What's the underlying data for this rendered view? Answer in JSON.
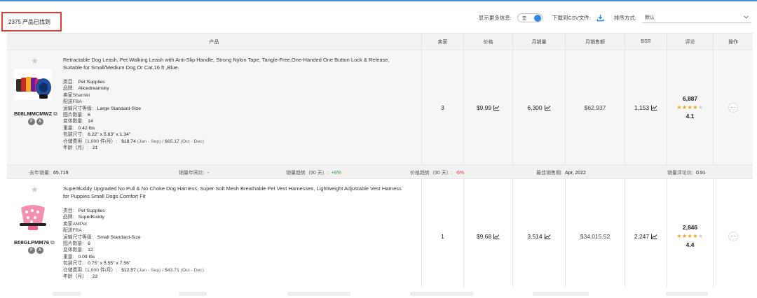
{
  "header": {
    "product_count": "2375 产品已找到",
    "show_more_label": "显示更多信息:",
    "toggle_text": "是",
    "download_label": "下载到CSV文件:",
    "sort_label": "排序方式:",
    "sort_value": "默认"
  },
  "columns": {
    "product": "产品",
    "seller": "卖家",
    "price": "价格",
    "monthly_sales": "月销量",
    "monthly_revenue": "月销售额",
    "bsr": "BSR",
    "reviews": "评论",
    "actions": "操作"
  },
  "products": [
    {
      "asin": "B08LMMCMWZ",
      "title_line1": "Retractable Dog Leash, Pet Walking Leash with Anti-Slip Handle, Strong Nylon Tape, Tangle-Free,One-Handed One Button Lock & Release,",
      "title_line2": "Suitable for Small/Medium Dog Or Cat,16 ft ,Blue.",
      "details": {
        "category_label": "类目:",
        "category": "Pet Supplies",
        "brand_label": "品牌:",
        "brand": "Alicedreamsky",
        "seller_label": "卖家",
        "seller": "Sharniki",
        "fulfillment_label": "配送",
        "fulfillment": "FBA",
        "size_tier_label": "运输尺寸等级:",
        "size_tier": "Large Standard-Size",
        "images_label": "图片数量:",
        "images": "6",
        "variants_label": "变体数量:",
        "variants": "14",
        "weight_label": "重量:",
        "weight": "0.42 lbs",
        "dims_label": "包装尺寸:",
        "dims": "6.22\" x 5.63\" x 1.34\"",
        "storage_label": "仓储费用（1,000 件/月）:",
        "storage_a": "$18.74",
        "storage_a_period": "(Jan - Sep) /",
        "storage_b": "$65.17",
        "storage_b_period": "(Oct - Dec)",
        "age_label": "年龄（月）:",
        "age": "21"
      },
      "sellers": "3",
      "price": "$9.99",
      "monthly_sales": "6,300",
      "monthly_revenue": "$62,937",
      "bsr": "1,153",
      "reviews": "6,887",
      "rating": "4.1",
      "rating_value": 4.1,
      "summary": {
        "last_year_label": "去年销量:",
        "last_year": "65,719",
        "yoy_label": "销量年同比:",
        "yoy": "-",
        "sales_trend_label": "销量趋势（90 天）:",
        "sales_trend": "+8%",
        "price_trend_label": "价格趋势（90 天）:",
        "price_trend": "-6%",
        "best_month_label": "最佳销售期:",
        "best_month": "Apr, 2022",
        "review_rate_label": "销量评论比:",
        "review_rate": "0.91"
      }
    },
    {
      "asin": "B08GLPMM76",
      "title_line1": "SuperBuddy Upgraded No Pull & No Choke Dog Harness, Super Soft Mesh Breathable Pet Vest Harnesses, Lightweight Adjustable Vest Harness",
      "title_line2": "for Puppies Small Dogs Comfort Fit",
      "details": {
        "category_label": "类目:",
        "category": "Pet Supplies",
        "brand_label": "品牌:",
        "brand": "SuperBuddy",
        "seller_label": "卖家",
        "seller": "AMPet",
        "fulfillment_label": "配送",
        "fulfillment": "FBA",
        "size_tier_label": "运输尺寸等级:",
        "size_tier": "Small Standard-Size",
        "images_label": "图片数量:",
        "images": "8",
        "variants_label": "变体数量:",
        "variants": "12",
        "weight_label": "重量:",
        "weight": "0.09 lbs",
        "dims_label": "包装尺寸:",
        "dims": "0.75\" x 5.55\" x 7.56\"",
        "storage_label": "仓储费用（1,000 件/月）:",
        "storage_a": "$12.57",
        "storage_a_period": "(Jan - Sep) /",
        "storage_b": "$43.71",
        "storage_b_period": "(Oct - Dec)",
        "age_label": "年龄（月）:",
        "age": "22"
      },
      "sellers": "1",
      "price": "$9.68",
      "monthly_sales": "3,514",
      "monthly_revenue": "$34,015.52",
      "bsr": "2,247",
      "reviews": "2,846",
      "rating": "4.4",
      "rating_value": 4.4
    }
  ],
  "badges": {
    "fba": "F",
    "amazon": "A"
  },
  "icons": {
    "pin": "pin-icon",
    "external": "external-link-icon",
    "trend": "trend-chart-icon",
    "download": "download-icon",
    "more": "more-dots-icon",
    "chevron": "chevron-down-icon"
  },
  "colors": {
    "accent": "#2f8be0",
    "highlight_border": "#e53935",
    "star": "#f0a41e",
    "positive": "#2e9e3e",
    "negative": "#e53935"
  }
}
